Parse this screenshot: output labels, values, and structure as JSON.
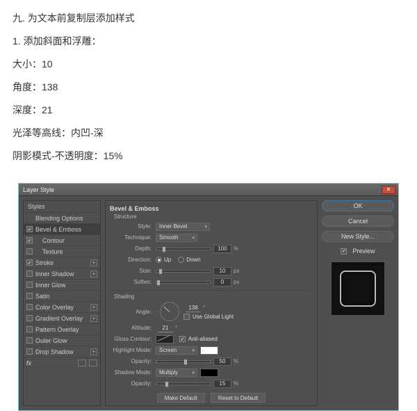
{
  "article": {
    "heading": "九. 为文本前复制层添加样式",
    "lines": [
      "1. 添加斜面和浮雕：",
      "大小：10",
      "角度：138",
      "深度：21",
      "光泽等高线：内凹-深",
      "阴影模式-不透明度：15%"
    ]
  },
  "dialog": {
    "title": "Layer Style",
    "close_glyph": "✕",
    "left": {
      "head": "Styles",
      "rows": [
        {
          "name": "blending-options",
          "label": "Blending Options",
          "checked": null,
          "indent": false,
          "plus": false,
          "selected": false
        },
        {
          "name": "bevel-emboss",
          "label": "Bevel & Emboss",
          "checked": true,
          "indent": false,
          "plus": false,
          "selected": true
        },
        {
          "name": "contour",
          "label": "Contour",
          "checked": true,
          "indent": true,
          "plus": false,
          "selected": false
        },
        {
          "name": "texture",
          "label": "Texture",
          "checked": false,
          "indent": true,
          "plus": false,
          "selected": false
        },
        {
          "name": "stroke",
          "label": "Stroke",
          "checked": true,
          "indent": false,
          "plus": true,
          "selected": false
        },
        {
          "name": "inner-shadow",
          "label": "Inner Shadow",
          "checked": false,
          "indent": false,
          "plus": true,
          "selected": false
        },
        {
          "name": "inner-glow",
          "label": "Inner Glow",
          "checked": false,
          "indent": false,
          "plus": false,
          "selected": false
        },
        {
          "name": "satin",
          "label": "Satin",
          "checked": false,
          "indent": false,
          "plus": false,
          "selected": false
        },
        {
          "name": "color-overlay",
          "label": "Color Overlay",
          "checked": false,
          "indent": false,
          "plus": true,
          "selected": false
        },
        {
          "name": "gradient-overlay",
          "label": "Gradient Overlay",
          "checked": false,
          "indent": false,
          "plus": true,
          "selected": false
        },
        {
          "name": "pattern-overlay",
          "label": "Pattern Overlay",
          "checked": false,
          "indent": false,
          "plus": false,
          "selected": false
        },
        {
          "name": "outer-glow",
          "label": "Outer Glow",
          "checked": false,
          "indent": false,
          "plus": false,
          "selected": false
        },
        {
          "name": "drop-shadow",
          "label": "Drop Shadow",
          "checked": false,
          "indent": false,
          "plus": true,
          "selected": false
        }
      ],
      "fx_label": "fx"
    },
    "center": {
      "title": "Bevel & Emboss",
      "structure_label": "Structure",
      "style_label": "Style:",
      "style_value": "Inner Bevel",
      "technique_label": "Technique:",
      "technique_value": "Smooth",
      "depth_label": "Depth:",
      "depth_value": "100",
      "depth_unit": "%",
      "direction_label": "Direction:",
      "up_label": "Up",
      "down_label": "Down",
      "size_label": "Size:",
      "size_value": "10",
      "size_unit": "px",
      "soften_label": "Soften:",
      "soften_value": "0",
      "soften_unit": "px",
      "shading_label": "Shading",
      "angle_label": "Angle:",
      "angle_value": "138",
      "global_light_label": "Use Global Light",
      "altitude_label": "Altitude:",
      "altitude_value": "21",
      "gloss_label": "Gloss Contour:",
      "antialiased_label": "Anti-aliased",
      "highlight_mode_label": "Highlight Mode:",
      "highlight_mode_value": "Screen",
      "highlight_opacity_label": "Opacity:",
      "highlight_opacity_value": "50",
      "highlight_opacity_unit": "%",
      "shadow_mode_label": "Shadow Mode:",
      "shadow_mode_value": "Multiply",
      "shadow_opacity_label": "Opacity:",
      "shadow_opacity_value": "15",
      "shadow_opacity_unit": "%",
      "make_default": "Make Default",
      "reset_default": "Reset to Default"
    },
    "right": {
      "ok": "OK",
      "cancel": "Cancel",
      "new_style": "New Style...",
      "preview": "Preview"
    }
  }
}
